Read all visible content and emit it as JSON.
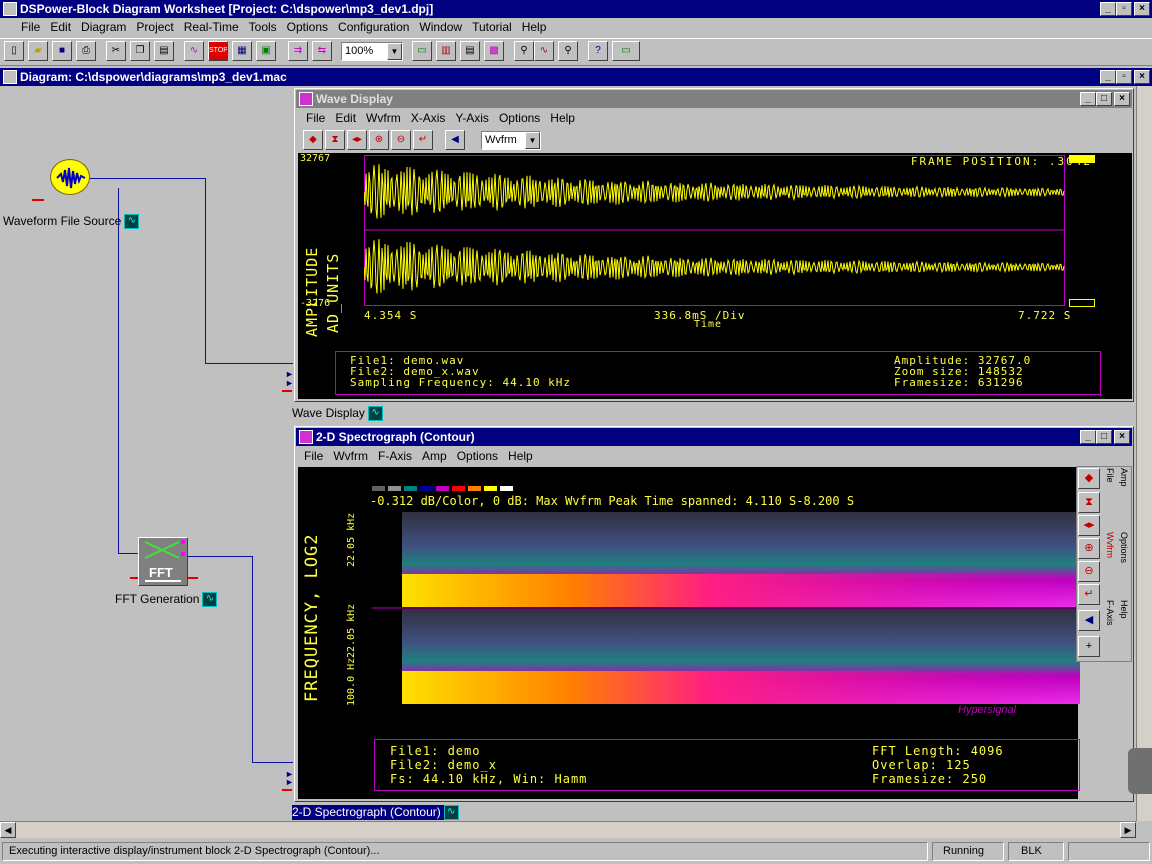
{
  "app": {
    "title": "DSPower-Block Diagram Worksheet [Project: C:\\dspower\\mp3_dev1.dpj]"
  },
  "menu": [
    "File",
    "Edit",
    "Diagram",
    "Project",
    "Real-Time",
    "Tools",
    "Options",
    "Configuration",
    "Window",
    "Tutorial",
    "Help"
  ],
  "toolbar": {
    "zoom": "100%"
  },
  "diagram": {
    "title": "Diagram: C:\\dspower\\diagrams\\mp3_dev1.mac",
    "blocks": {
      "source": "Waveform File Source",
      "fft": "FFT Generation",
      "fft_text": "FFT",
      "wave": "Wave Display",
      "spectro": "2-D Spectrograph (Contour)"
    }
  },
  "wave": {
    "title": "Wave Display",
    "menu": [
      "File",
      "Edit",
      "Wvfrm",
      "X-Axis",
      "Y-Axis",
      "Options",
      "Help"
    ],
    "select": "Wvfrm",
    "frame_position": "FRAME POSITION: .3042",
    "y_max": "32767",
    "y_min": "-3276",
    "y_label": "AMPLITUDE",
    "y_units": "AD_UNITS",
    "x_start": "4.354  S",
    "x_mid": "336.8mS /Div",
    "x_end": "7.722  S",
    "x_label": "Time",
    "info": {
      "file1": "File1: demo.wav",
      "file2": "File2: demo_x.wav",
      "fs": "Sampling Frequency: 44.10 kHz",
      "amp": "Amplitude: 32767.0",
      "zoom": "Zoom size: 148532",
      "frame": "Framesize: 631296"
    }
  },
  "spectro": {
    "title": "2-D Spectrograph (Contour)",
    "menu": [
      "File",
      "Wvfrm",
      "F-Axis",
      "Amp",
      "Options",
      "Help"
    ],
    "header": "-0.312 dB/Color, 0 dB: Max Wvfrm Peak  Time spanned: 4.110 S-8.200 S",
    "y_label": "FREQUENCY, LOG2",
    "f_top": "22.05 kHz",
    "f_mid": "22.05 kHz",
    "f_bot": "100.0 Hz",
    "brand": "Hypersignal",
    "side": {
      "amp": "Amp",
      "file": "File",
      "options": "Options",
      "wvfrm": "Wvfrm",
      "help": "Help",
      "faxis": "F-Axis"
    },
    "info": {
      "file1": "File1: demo",
      "file2": "File2: demo_x",
      "fs": "Fs: 44.10 kHz, Win: Hamm",
      "fft": "FFT Length: 4096",
      "overlap": "Overlap: 125",
      "frame": "Framesize: 250"
    },
    "swatches": [
      "#606060",
      "#909090",
      "#008080",
      "#000090",
      "#c000c0",
      "#ff0000",
      "#ff8000",
      "#ffff00",
      "#ffffff"
    ]
  },
  "status": {
    "message": "Executing interactive display/instrument block 2-D Spectrograph (Contour)...",
    "state": "Running",
    "mode": "BLK"
  }
}
